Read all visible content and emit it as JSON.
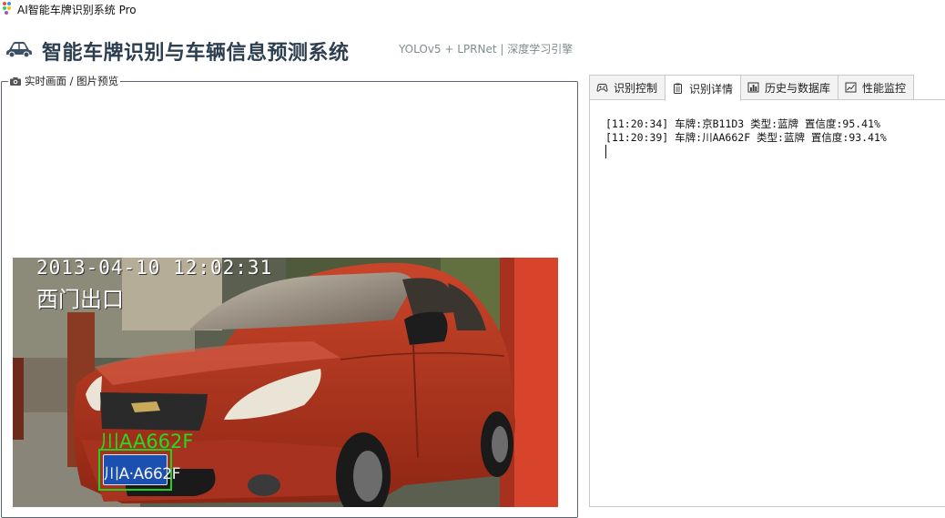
{
  "window": {
    "title": "AI智能车牌识别系统 Pro",
    "logo_colors": [
      "#e74c3c",
      "#3498db",
      "#2ecc71",
      "#f1c40f"
    ]
  },
  "header": {
    "title": "智能车牌识别与车辆信息预测系统",
    "subtitle": "YOLOv5 + LPRNet | 深度学习引擎",
    "title_color": "#2c3e50",
    "subtitle_color": "#7f8c8d"
  },
  "preview": {
    "group_title": "实时画面 / 图片预览",
    "osd_datetime": "2013-04-10 12:02:31",
    "osd_location": "西门出口",
    "detection_label": "川AA662F",
    "plate_text": "川A·A662F",
    "box_color": "#1fd21f",
    "car_color": "#b8351f"
  },
  "tabs": [
    {
      "label": "识别控制",
      "icon": "gamepad-icon",
      "active": false
    },
    {
      "label": "识别详情",
      "icon": "clipboard-icon",
      "active": true
    },
    {
      "label": "历史与数据库",
      "icon": "bar-chart-icon",
      "active": false
    },
    {
      "label": "性能监控",
      "icon": "line-chart-icon",
      "active": false
    }
  ],
  "details": {
    "log_lines": [
      "[11:20:34] 车牌:京B11D3 类型:蓝牌 置信度:95.41%",
      "[11:20:39] 车牌:川AA662F 类型:蓝牌 置信度:93.41%"
    ]
  }
}
